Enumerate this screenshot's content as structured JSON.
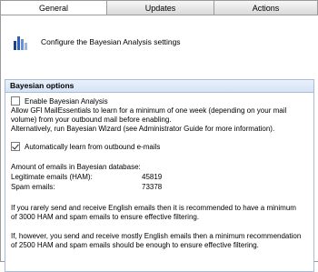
{
  "tabs": [
    {
      "label": "General",
      "active": true
    },
    {
      "label": "Updates",
      "active": false
    },
    {
      "label": "Actions",
      "active": false
    }
  ],
  "header": {
    "icon": "bar-chart-icon",
    "text": "Configure the Bayesian Analysis settings"
  },
  "section": {
    "title": "Bayesian options",
    "enable": {
      "label": "Enable Bayesian Analysis",
      "checked": false
    },
    "enable_desc_1": "Allow GFI MailEssentials to learn for a minimum of one week (depending on your mail",
    "enable_desc_2": "volume) from your outbound mail before enabling.",
    "enable_desc_3": "Alternatively, run Bayesian Wizard (see Administrator Guide for more information).",
    "auto_learn": {
      "label": "Automatically learn from outbound e-mails",
      "checked": true
    },
    "db_heading": "Amount of emails in Bayesian database:",
    "ham_label": "Legitimate emails (HAM):",
    "ham_value": "45819",
    "spam_label": "Spam emails:",
    "spam_value": "73378",
    "note1_line1": "If you rarely send and receive English emails then it is recommended to have a minimum",
    "note1_line2": "of 3000 HAM and spam emails to ensure effective filtering.",
    "note2_line1": "If, however, you send and receive mostly English emails then a minimum recommendation",
    "note2_line2": "of 2500 HAM and spam emails should be enough to ensure effective filtering."
  }
}
